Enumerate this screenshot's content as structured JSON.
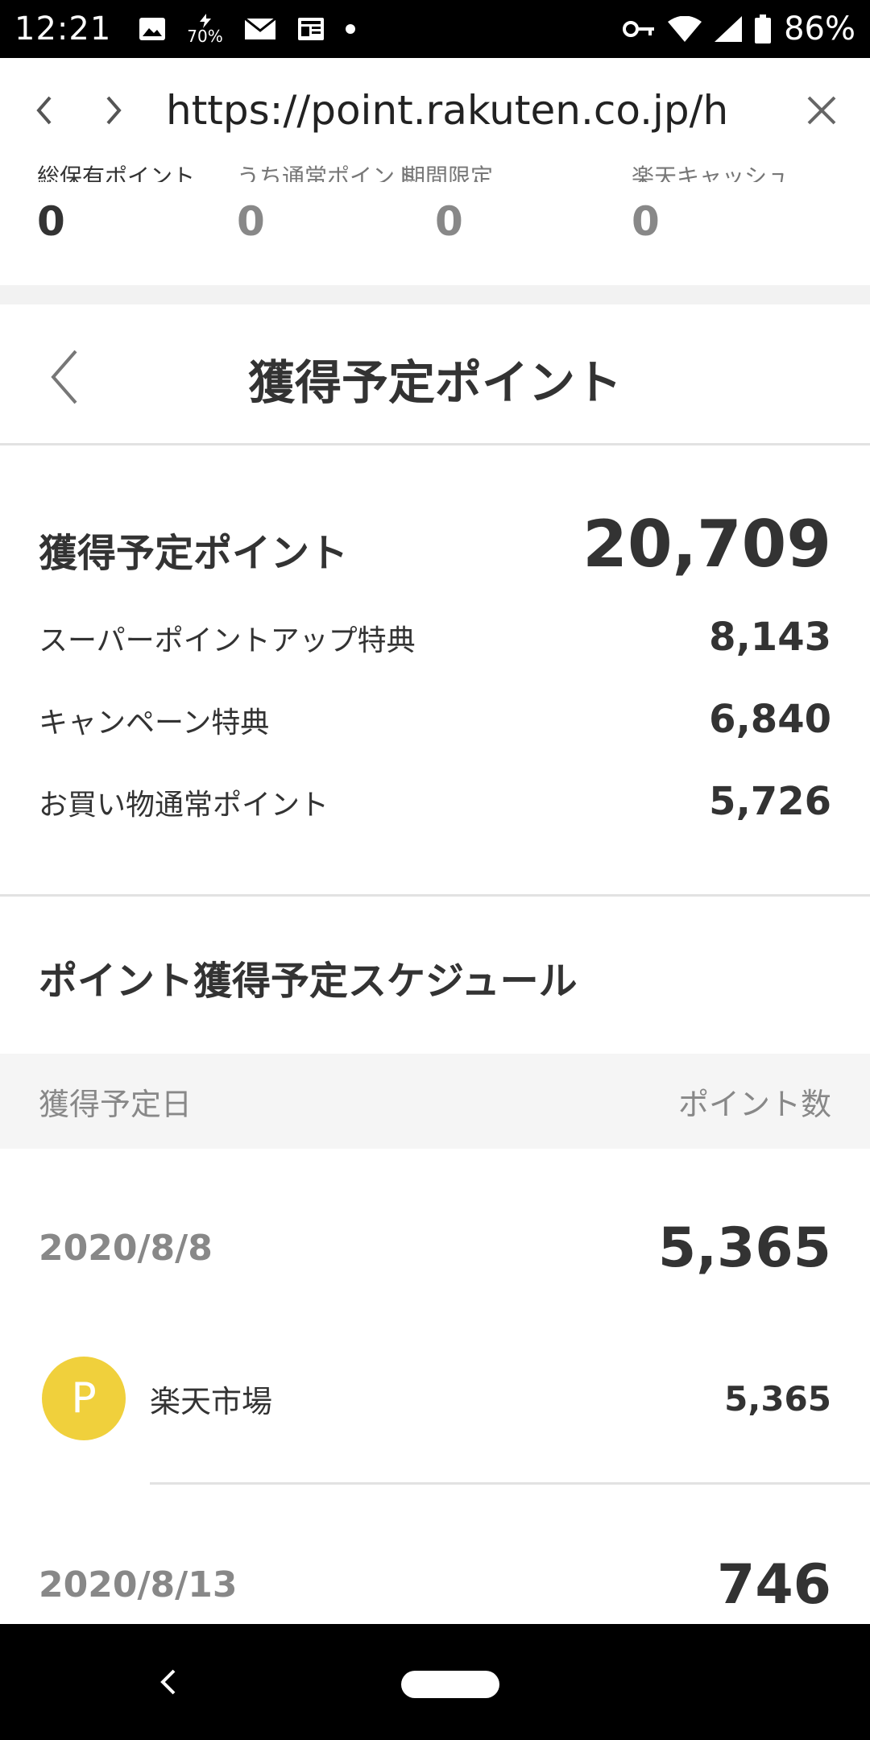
{
  "status_bar": {
    "time": "12:21",
    "notif_70": "70%",
    "battery": "86%"
  },
  "browser": {
    "url": "https://point.rakuten.co.jp/hi"
  },
  "summary": [
    {
      "label": "総保有ポイント",
      "value": "0"
    },
    {
      "label": "うち通常ポイント",
      "value": "0"
    },
    {
      "label": "期間限定",
      "value": "0"
    },
    {
      "label": "楽天キャッシュ",
      "value": "0"
    }
  ],
  "page": {
    "title": "獲得予定ポイント"
  },
  "totals": {
    "main_label": "獲得予定ポイント",
    "main_value": "20,709",
    "items": [
      {
        "label": "スーパーポイントアップ特典",
        "value": "8,143"
      },
      {
        "label": "キャンペーン特典",
        "value": "6,840"
      },
      {
        "label": "お買い物通常ポイント",
        "value": "5,726"
      }
    ]
  },
  "schedule": {
    "title": "ポイント獲得予定スケジュール",
    "col_date": "獲得予定日",
    "col_points": "ポイント数",
    "entries": [
      {
        "date": "2020/8/8",
        "points": "5,365",
        "items": [
          {
            "avatar": "P",
            "name": "楽天市場",
            "points": "5,365"
          }
        ]
      },
      {
        "date": "2020/8/13",
        "points": "746"
      }
    ]
  },
  "colors": {
    "avatar_bg": "#f0d03c",
    "band": "#f2f2f2"
  }
}
